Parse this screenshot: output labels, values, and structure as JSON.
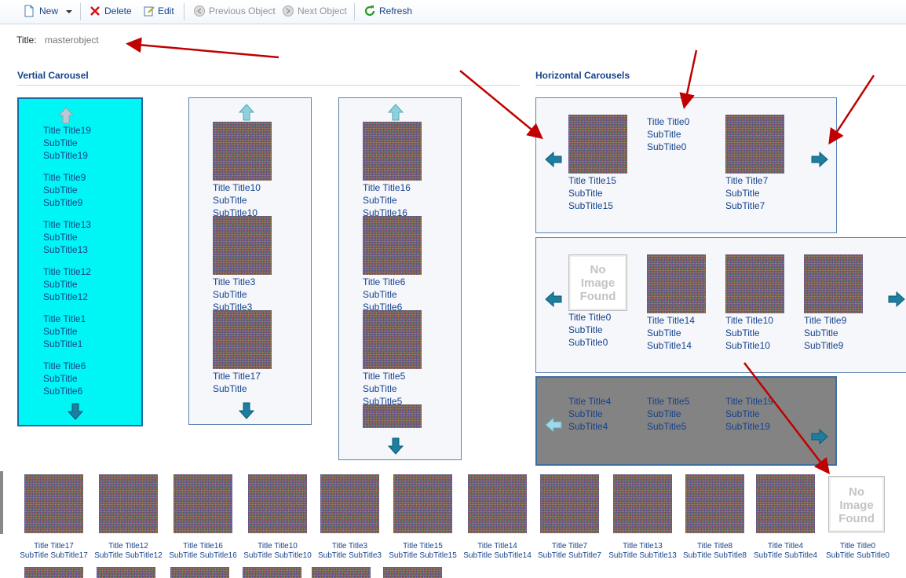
{
  "toolbar": {
    "new_label": "New",
    "delete_label": "Delete",
    "edit_label": "Edit",
    "previous_label": "Previous Object",
    "next_label": "Next Object",
    "refresh_label": "Refresh"
  },
  "form": {
    "title_label": "Title:",
    "title_value": "masterobject"
  },
  "vertical": {
    "heading": "Vertial Carousel",
    "cyan_items": [
      {
        "t": "Title Title19",
        "s": "SubTitle",
        "s2": "SubTitle19"
      },
      {
        "t": "Title Title9",
        "s": "SubTitle",
        "s2": "SubTitle9"
      },
      {
        "t": "Title Title13",
        "s": "SubTitle",
        "s2": "SubTitle13"
      },
      {
        "t": "Title Title12",
        "s": "SubTitle",
        "s2": "SubTitle12"
      },
      {
        "t": "Title Title1",
        "s": "SubTitle",
        "s2": "SubTitle1"
      },
      {
        "t": "Title Title6",
        "s": "SubTitle",
        "s2": "SubTitle6"
      }
    ],
    "col2_items": [
      {
        "t": "Title Title10",
        "s": "SubTitle",
        "s2": "SubTitle10"
      },
      {
        "t": "Title Title3",
        "s": "SubTitle",
        "s2": "SubTitle3"
      },
      {
        "t": "Title Title17",
        "s": "SubTitle",
        "s2": ""
      }
    ],
    "col3_items": [
      {
        "t": "Title Title16",
        "s": "SubTitle",
        "s2": "SubTitle16"
      },
      {
        "t": "Title Title6",
        "s": "SubTitle",
        "s2": "SubTitle6"
      },
      {
        "t": "Title Title5",
        "s": "SubTitle",
        "s2": "SubTitle5"
      }
    ]
  },
  "horizontal": {
    "heading": "Horizontal Carousels",
    "row1": [
      {
        "t": "Title Title15",
        "s": "SubTitle",
        "s2": "SubTitle15"
      },
      {
        "t": "Title Title0",
        "s": "SubTitle",
        "s2": "SubTitle0"
      },
      {
        "t": "Title Title7",
        "s": "SubTitle",
        "s2": "SubTitle7"
      }
    ],
    "row2": [
      {
        "t": "Title Title0",
        "s": "SubTitle",
        "s2": "SubTitle0"
      },
      {
        "t": "Title Title14",
        "s": "SubTitle",
        "s2": "SubTitle14"
      },
      {
        "t": "Title Title10",
        "s": "SubTitle",
        "s2": "SubTitle10"
      },
      {
        "t": "Title Title9",
        "s": "SubTitle",
        "s2": "SubTitle9"
      }
    ],
    "row3": [
      {
        "t": "Title Title4",
        "s": "SubTitle",
        "s2": "SubTitle4"
      },
      {
        "t": "Title Title5",
        "s": "SubTitle",
        "s2": "SubTitle5"
      },
      {
        "t": "Title Title19",
        "s": "SubTitle",
        "s2": "SubTitle19"
      }
    ]
  },
  "no_image": {
    "l1": "No",
    "l2": "Image",
    "l3": "Found"
  },
  "strip": [
    {
      "t": "Title Title17",
      "s": "SubTitle SubTitle17"
    },
    {
      "t": "Title Title12",
      "s": "SubTitle SubTitle12"
    },
    {
      "t": "Title Title16",
      "s": "SubTitle SubTitle16"
    },
    {
      "t": "Title Title10",
      "s": "SubTitle SubTitle10"
    },
    {
      "t": "Title Title3",
      "s": "SubTitle SubTitle3"
    },
    {
      "t": "Title Title15",
      "s": "SubTitle SubTitle15"
    },
    {
      "t": "Title Title14",
      "s": "SubTitle SubTitle14"
    },
    {
      "t": "Title Title7",
      "s": "SubTitle SubTitle7"
    },
    {
      "t": "Title Title13",
      "s": "SubTitle SubTitle13"
    },
    {
      "t": "Title Title8",
      "s": "SubTitle SubTitle8"
    },
    {
      "t": "Title Title4",
      "s": "SubTitle SubTitle4"
    },
    {
      "t": "Title Title0",
      "s": "SubTitle SubTitle0"
    }
  ],
  "colors": {
    "link": "#15428b",
    "cyan": "#00f5f5",
    "gray": "#838383",
    "arrow_red": "#c00000",
    "nav_teal": "#1f8fb0"
  }
}
